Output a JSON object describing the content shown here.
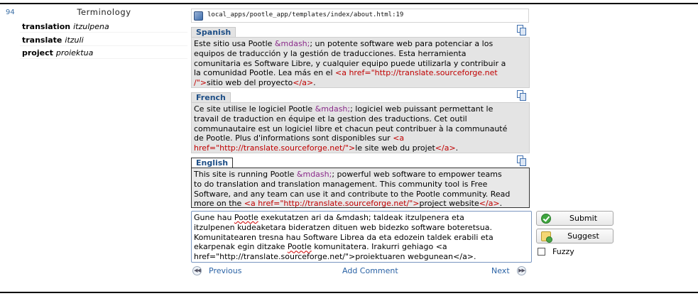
{
  "unit": {
    "index": "94"
  },
  "terminology": {
    "title": "Terminology",
    "items": [
      {
        "source": "translation",
        "target": "itzulpena"
      },
      {
        "source": "translate",
        "target": "itzuli"
      },
      {
        "source": "project",
        "target": "proiektua"
      }
    ]
  },
  "location": {
    "text": "local_apps/pootle_app/templates/index/about.html:19"
  },
  "alt_sources": [
    {
      "language": "Spanish",
      "lines": [
        [
          [
            "t",
            "Este sitio usa Pootle "
          ],
          [
            "e",
            "&mdash;"
          ],
          [
            "t",
            "; un potente software web para potenciar a los"
          ]
        ],
        [
          [
            "t",
            "equipos de traducción y la gestión de traducciones. Esta herramienta"
          ]
        ],
        [
          [
            "t",
            "comunitaria es Software Libre, y cualquier equipo puede utilizarla y contribuir a"
          ]
        ],
        [
          [
            "t",
            "la comunidad Pootle. Lea más en el "
          ],
          [
            "g",
            "<a href=\"http://translate.sourceforge.net"
          ]
        ],
        [
          [
            "g",
            "/\">"
          ],
          [
            "t",
            "sitio web del proyecto"
          ],
          [
            "g",
            "</a>"
          ],
          [
            "t",
            "."
          ]
        ]
      ]
    },
    {
      "language": "French",
      "lines": [
        [
          [
            "t",
            "Ce site utilise le logiciel Pootle "
          ],
          [
            "e",
            "&mdash;"
          ],
          [
            "t",
            "; logiciel web puissant permettant le"
          ]
        ],
        [
          [
            "t",
            "travail de traduction en équipe et la gestion des traductions. Cet outil"
          ]
        ],
        [
          [
            "t",
            "communautaire est un logiciel libre et chacun peut contribuer à la communauté"
          ]
        ],
        [
          [
            "t",
            "de Pootle. Plus d'informations sont disponibles sur "
          ],
          [
            "g",
            "<a"
          ]
        ],
        [
          [
            "g",
            "href=\"http://translate.sourceforge.net/\">"
          ],
          [
            "t",
            "le site web du projet"
          ],
          [
            "g",
            "</a>"
          ],
          [
            "t",
            "."
          ]
        ]
      ]
    }
  ],
  "source": {
    "language": "English",
    "lines": [
      [
        [
          "t",
          "This site is running Pootle "
        ],
        [
          "e",
          "&mdash;"
        ],
        [
          "t",
          "; powerful web software to empower teams"
        ]
      ],
      [
        [
          "t",
          "to do translation and translation management. This community tool is Free"
        ]
      ],
      [
        [
          "t",
          "Software, and any team can use it and contribute to the Pootle community. Read"
        ]
      ],
      [
        [
          "t",
          "more on the "
        ],
        [
          "g",
          "<a href=\"http://translate.sourceforge.net/\">"
        ],
        [
          "t",
          "project website"
        ],
        [
          "g",
          "</a>"
        ],
        [
          "t",
          "."
        ]
      ]
    ]
  },
  "translation": {
    "lines": [
      [
        [
          "t",
          "Gune hau "
        ],
        [
          "s",
          "Pootle"
        ],
        [
          "t",
          " exekutatzen ari da &mdash; taldeak itzulpenera eta"
        ]
      ],
      [
        [
          "t",
          "itzulpenen kudeaketara bideratzen dituen web bidezko software boteretsua."
        ]
      ],
      [
        [
          "t",
          "Komunitatearen tresna hau Software Librea da eta edozein taldek erabili eta"
        ]
      ],
      [
        [
          "t",
          "ekarpenak egin ditzake "
        ],
        [
          "s",
          "Pootle"
        ],
        [
          "t",
          " komunitatera. Irakurri gehiago <a"
        ]
      ],
      [
        [
          "t",
          "href=\"http://translate.sourceforge.net/\">proiektuaren webgunean</a>."
        ]
      ]
    ]
  },
  "navigation": {
    "previous_label": "Previous",
    "add_comment_label": "Add Comment",
    "next_label": "Next"
  },
  "actions": {
    "submit_label": "Submit",
    "suggest_label": "Suggest",
    "fuzzy_label": "Fuzzy",
    "fuzzy_checked": false
  },
  "colors": {
    "entity": "#8a2a8a",
    "tag": "#c00000",
    "language_tab": "#1d4e86",
    "link": "#2a62a5"
  }
}
